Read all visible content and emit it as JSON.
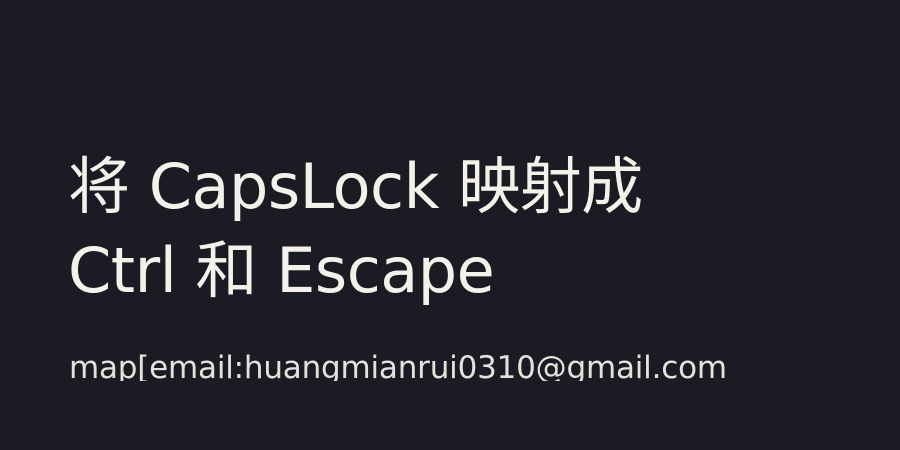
{
  "card": {
    "title_line_1": "将 CapsLock 映射成",
    "title_line_2": "Ctrl 和 Escape",
    "meta": "map[email:huangmianrui0310@gmail.com"
  },
  "colors": {
    "background": "#1b1c23",
    "title_text": "#f4f1ea",
    "meta_text": "#e5e2dc"
  }
}
